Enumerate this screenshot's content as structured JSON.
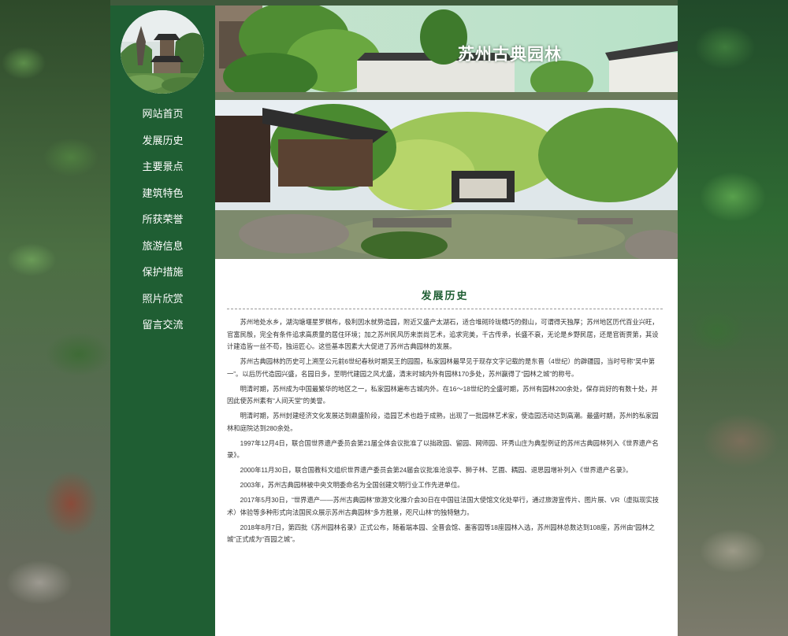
{
  "site": {
    "title": "苏州古典园林",
    "primary_color": "#1f5e33"
  },
  "nav": [
    {
      "label": "网站首页"
    },
    {
      "label": "发展历史"
    },
    {
      "label": "主要景点"
    },
    {
      "label": "建筑特色"
    },
    {
      "label": "所获荣誉"
    },
    {
      "label": "旅游信息"
    },
    {
      "label": "保护措施"
    },
    {
      "label": "照片欣赏"
    },
    {
      "label": "留言交流"
    }
  ],
  "section": {
    "title": "发展历史",
    "paragraphs": [
      "苏州地处水乡，湖沟塘堰星罗棋布，极利因水就势造园，附近又盛产太湖石，适合堆砌玲珑精巧的假山，可谓得天独厚；苏州地区历代百业兴旺，官富民殷，完全有条件追求高质量的居住环境；加之苏州民风历来崇尚艺术，追求完美，千古传承，长盛不衰，无论是乡野民居，还是官衙贾第，其设计建造皆一丝不苟，独运匠心。这些基本因素大大促进了苏州古典园林的发展。",
      "苏州古典园林的历史可上溯至公元前6世纪春秋时期吴王的园囿，私家园林最早见于现存文字记载的是东晋（4世纪）的辟疆园，当时号称“吴中第一”。以后历代造园兴盛，名园日多，至明代建园之风尤盛，清末时城内外有园林170多处，苏州赢得了“园林之城”的称号。",
      "明清时期，苏州成为中国最繁华的地区之一，私家园林遍布古城内外。在16～18世纪的全盛时期，苏州有园林200余处，保存尚好的有数十处，并因此使苏州素有“人间天堂”的美誉。",
      "明清时期，苏州封建经济文化发展达到鼎盛阶段，造园艺术也趋于成熟，出现了一批园林艺术家，使造园活动达到高潮。最盛时期，苏州的私家园林和庭院达到280余处。",
      "1997年12月4日，联合国世界遗产委员会第21届全体会议批准了以拙政园、留园、网师园、环秀山庄为典型例证的苏州古典园林列入《世界遗产名录》。",
      "2000年11月30日，联合国教科文组织世界遗产委员会第24届会议批准沧浪亭、狮子林、艺圃、耦园、退思园增补列入《世界遗产名录》。",
      "2003年，苏州古典园林被中央文明委命名为全国创建文明行业工作先进单位。",
      "2017年5月30日，“世界遗产——苏州古典园林”旅游文化推介会30日在中国驻法国大使馆文化处举行，通过旅游宣传片、图片展、VR（虚拟现实技术）体验等多种形式向法国民众展示苏州古典园林“多方胜景，咫尺山林”的独特魅力。",
      "2018年8月7日，第四批《苏州园林名录》正式公布，随着端本园、全晋会馆、墨客园等18座园林入选，苏州园林总数达到108座，苏州由“园林之城”正式成为“百园之城”。"
    ]
  }
}
